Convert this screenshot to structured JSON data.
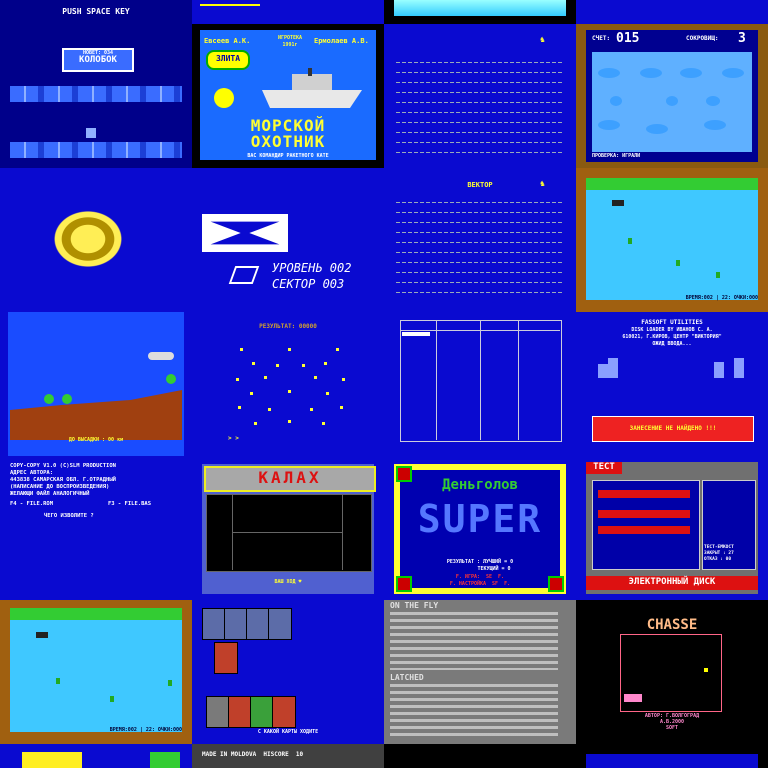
{
  "tiles": [
    {
      "id": "push-space",
      "text": "PUSH SPACE KEY",
      "title_line1": "НОВЕТ: 034",
      "title_line2": "КОЛОБОК"
    },
    {
      "id": "top-strip-2"
    },
    {
      "id": "top-strip-3"
    },
    {
      "id": "top-strip-4"
    },
    {
      "id": "morskoy-okhotnik",
      "author_left": "Евсеев А.К.",
      "author_mid_line1": "ИГРОТЕКА",
      "author_mid_line2": "1991г",
      "author_right": "Ермолаев А.В.",
      "badge": "ЗЛИТА",
      "title_line1": "МОРСКОЙ",
      "title_line2": "ОХОТНИК",
      "subtitle": "ВАС КОМАНДИР РАКЕТНОГО КАТЕ"
    },
    {
      "id": "lines-screen-1"
    },
    {
      "id": "ocean-score",
      "score_label": "СЧЕТ:",
      "score_value": "015",
      "lives_label": "СОКРОВИЩ:",
      "lives_value": "3",
      "status": "ПРОВЕРКА: ИГРАЛИ"
    },
    {
      "id": "tiger-logo"
    },
    {
      "id": "level-sector",
      "level": "УРОВЕНЬ 002",
      "sector": "СЕКТОР 003"
    },
    {
      "id": "vector-lines",
      "title": "ВЕКТОР"
    },
    {
      "id": "field-green-1",
      "footer": "ВРЕМЯ:002 | 22: ОЧКИ:000"
    },
    {
      "id": "helicopter",
      "footer": "ДО ВЫСАДКИ : 00 км"
    },
    {
      "id": "stars-result",
      "title": "РЕЗУЛЬТАТ: 00000"
    },
    {
      "id": "table-screen"
    },
    {
      "id": "fassoft",
      "line1": "FASSOFT UTILITIES",
      "line2": "DISK LOADER BY ИВАНОВ С. А.",
      "line3": "610021, Г.КИРОВ, ЦЕНТР \"ВИКТОРИЯ\"",
      "line4": "ОЖИД ВВОДА...",
      "error": "ЗАНЕСЕНИЕ НЕ НАЙДЕНО !!!"
    },
    {
      "id": "copy-copy",
      "line1": "COPY-COPY V1.0 (C)SLM PRODUCTION",
      "line2": "АДРЕС АВТОРА:",
      "line3": "443838 САМАРСКАЯ ОБЛ. Г.ОТРАДНЫЙ",
      "line4": "(НАПИСАНИЕ ДО ВОСПРОИЗВЕДЕНИЯ)",
      "line5": "ЖЕЛАЮЩИ ФАЙЛ АНАЛОГИЧНЫЙ",
      "f4": "F4 - FILE.ROM",
      "f3": "F3 - FILE.BAS",
      "prompt": "ЧЕГО ИЗВОЛИТЕ ?"
    },
    {
      "id": "kalakh",
      "title": "КАЛАХ",
      "footer": "ВАШ ХОД ♥"
    },
    {
      "id": "dengolov",
      "title": "Деньголов",
      "big": "SUPER",
      "result": "РЕЗУЛЬТАТ : ЛУЧШИЙ = 0",
      "result2": "ТЕКУЩИЙ = 0",
      "menu1": "F. ИГРА:  SE  F.",
      "menu2": "F. НАСТРОЙКА  SF  F."
    },
    {
      "id": "test-disk",
      "header": "ТЕСТ",
      "footer": "ЭЛЕКТРОННЫЙ ДИСК",
      "side1": "ТЕСТ-ЕМКОСТ",
      "side2": "ЗАКРЫТ : 27",
      "side3": "ОТКАЗ : 00"
    },
    {
      "id": "field-green-2",
      "footer": "ВРЕМЯ:002 | 22: ОЧКИ:000"
    },
    {
      "id": "cards",
      "footer": "С КАКОЙ КАРТЫ ХОДИТЕ"
    },
    {
      "id": "on-the-fly",
      "header": "ON THE FLY",
      "latched": "LATCHED"
    },
    {
      "id": "chasse",
      "title": "CHASSE",
      "credit1": "АВТОР: Г.ВОЛГОГРАД",
      "credit2": "А.В.2000",
      "credit3": "SOFT"
    },
    {
      "id": "bottom-1"
    },
    {
      "id": "bottom-2",
      "text": "MADE IN MOLDOVA  HISCORE  10"
    },
    {
      "id": "bottom-3"
    },
    {
      "id": "bottom-4"
    }
  ],
  "colors": {
    "blue": "#0a0ad0",
    "darkblue": "#0000a8",
    "brown": "#a06010",
    "black": "#000000"
  }
}
